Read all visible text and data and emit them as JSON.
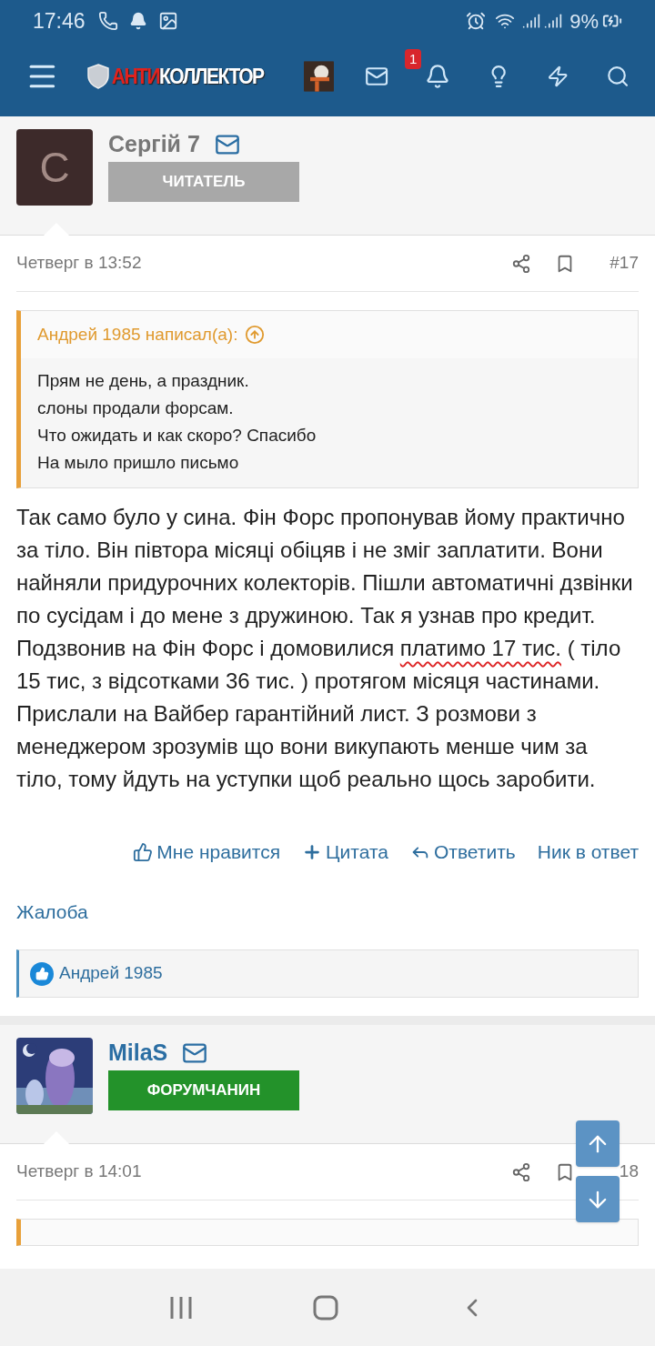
{
  "status_bar": {
    "time": "17:46",
    "battery": "9%"
  },
  "header": {
    "logo_accent": "АНТИ",
    "logo_rest": "КОЛЛЕКТОР",
    "alerts_badge": "1"
  },
  "posts": [
    {
      "author": "Сергій 7",
      "avatar_letter": "С",
      "kind": "letter",
      "role": "ЧИТАТЕЛЬ",
      "color": "#a8a8a8",
      "date": "Четверг в 13:52",
      "number": "#17",
      "quote": {
        "author": "Андрей 1985 написал(а):",
        "lines": [
          "Прям не день, а праздник.",
          "слоны продали форсам.",
          "Что ожидать и как скоро? Спасибо",
          "На мыло пришло письмо"
        ]
      },
      "body": {
        "before": "Так само було у сина. Фін Форс пропонував йому практично за тіло. Він півтора місяці обіцяв і не зміг заплатити. Вони найняли придурочних колекторів. Пішли автоматичні дзвінки по сусідам і до мене з дружиною. Так я узнав про кредит. Подзвонив на Фін Форс і домовилися ",
        "marked": "платимо 17 тис.",
        "after": " ( тіло 15 тис, з відсотками 36 тис. ) протягом місяця частинами. Прислали на Вайбер гарантійний лист. З розмови з менеджером зрозумів що вони викупають менше чим за тіло, тому йдуть на уступки щоб реально щось заробити."
      },
      "actions": [
        "Мне нравится",
        "Цитата",
        "Ответить",
        "Ник в ответ"
      ],
      "report": "Жалоба",
      "likes": "Андрей 1985"
    },
    {
      "author": "MilaS",
      "kind": "picture",
      "role": "ФОРУМЧАНИН",
      "color": "#23922a",
      "date": "Четверг в 14:01",
      "number": "18",
      "quote_cut": true
    }
  ]
}
